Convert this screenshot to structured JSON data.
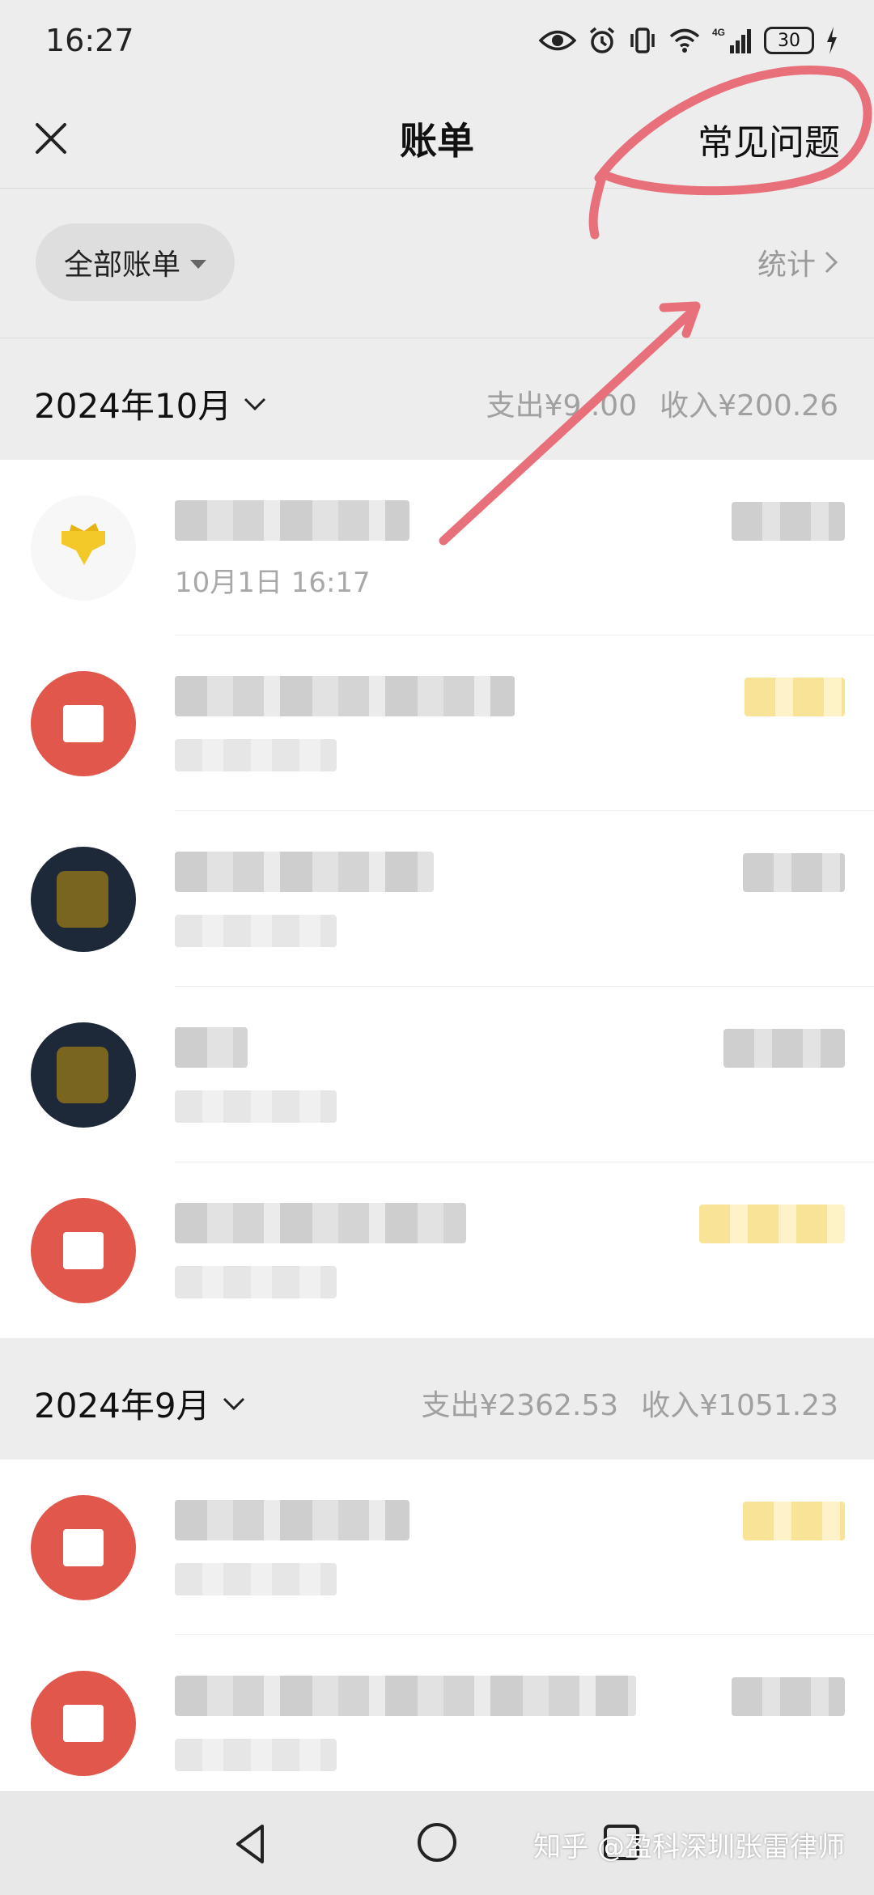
{
  "status_bar": {
    "time": "16:27",
    "battery": "30",
    "icons": [
      "eye-icon",
      "alarm-icon",
      "vibrate-icon",
      "wifi-icon",
      "signal-4g-icon",
      "battery-icon",
      "charging-icon"
    ]
  },
  "nav": {
    "title": "账单",
    "faq": "常见问题",
    "close_icon": "close-icon"
  },
  "filter": {
    "label": "全部账单",
    "stats": "统计"
  },
  "months": [
    {
      "label": "2024年10月",
      "expense": "支出¥9 .00",
      "income": "收入¥200.26",
      "rows": [
        {
          "avatar": "gift",
          "time": "10月1日 16:17",
          "amount_color": "gray"
        },
        {
          "avatar": "red",
          "amount_color": "yellow"
        },
        {
          "avatar": "dark",
          "amount_color": "gray"
        },
        {
          "avatar": "dark",
          "amount_color": "gray"
        },
        {
          "avatar": "red",
          "amount_color": "yellow"
        }
      ]
    },
    {
      "label": "2024年9月",
      "expense": "支出¥2362.53",
      "income": "收入¥1051.23",
      "rows": [
        {
          "avatar": "red",
          "amount_color": "yellow"
        },
        {
          "avatar": "red",
          "amount_color": "gray"
        }
      ]
    }
  ],
  "watermark": "知乎 @盈科深圳张雷律师",
  "colors": {
    "background": "#ededed",
    "list_bg": "#ffffff",
    "annotation": "#e8707a",
    "avatar_red": "#e1574c"
  }
}
